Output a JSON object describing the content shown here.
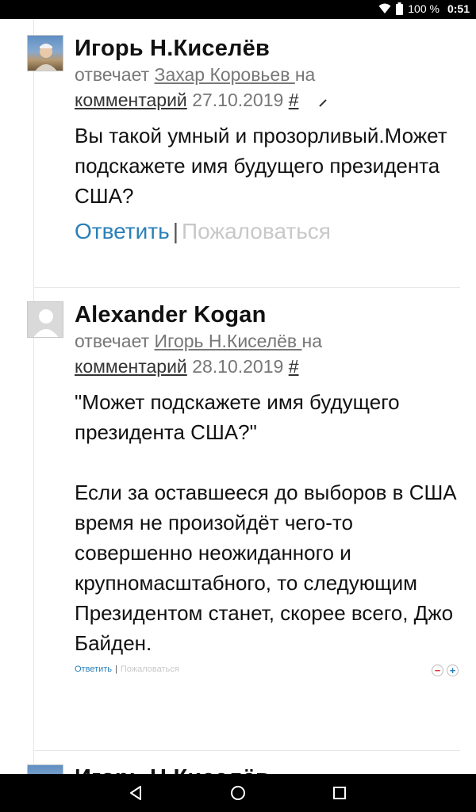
{
  "statusbar": {
    "battery": "100 %",
    "time": "0:51",
    "icons": [
      "wifi-icon",
      "battery-icon"
    ]
  },
  "comments": [
    {
      "author": "Игорь Н.Киселёв",
      "replies_word": "отвечает",
      "reply_to": "Захар Коровьев ",
      "on_word": "на",
      "comment_link": "комментарий",
      "date": "27.10.2019",
      "anchor": "#",
      "text": "Вы такой умный и прозорливый.Может подскажете имя будущего президента США?",
      "reply": "Ответить",
      "separator": "|",
      "report": "Пожаловаться"
    },
    {
      "author": "Alexander Kogan",
      "replies_word": "отвечает",
      "reply_to": "Игорь Н.Киселёв ",
      "on_word": "на",
      "comment_link": "комментарий",
      "date": "28.10.2019",
      "anchor": "#",
      "text": "\"Может подскажете имя будущего президента США?\"\n\nЕсли за оставшееся до выборов в США время не произойдёт чего-то совершенно неожиданного и крупномасштабного, то следующим Президентом станет, скорее всего, Джо Байден.",
      "reply": "Ответить",
      "separator": "|",
      "report": "Пожаловаться",
      "vote_minus": "−",
      "vote_plus": "+"
    },
    {
      "author": "Игорь Н.Киселёв"
    }
  ],
  "navbar": {
    "icons": [
      "back-icon",
      "home-icon",
      "recents-icon"
    ]
  },
  "colors": {
    "link": "#2a7fb8",
    "muted": "#777777",
    "report": "#c8c8c8"
  }
}
